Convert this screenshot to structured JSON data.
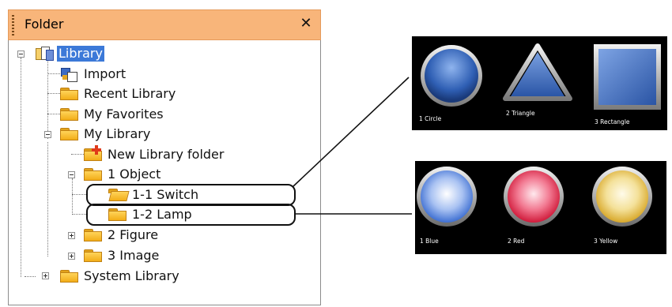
{
  "panel": {
    "title": "Folder",
    "close_glyph": "✕"
  },
  "tree": {
    "library": "Library",
    "import": "Import",
    "recent_library": "Recent Library",
    "my_favorites": "My Favorites",
    "my_library": "My Library",
    "new_library_folder": "New Library folder",
    "object": "1 Object",
    "switch": "1-1 Switch",
    "lamp": "1-2 Lamp",
    "figure": "2 Figure",
    "image": "3 Image",
    "system_library": "System Library"
  },
  "switch_preview": {
    "items": [
      "1 Circle",
      "2 Triangle",
      "3 Rectangle"
    ]
  },
  "lamp_preview": {
    "items": [
      "1 Blue",
      "2 Red",
      "3 Yellow"
    ]
  },
  "colors": {
    "header_bg": "#f8b57a",
    "selection_bg": "#3c79d8",
    "callout_stroke": "#111111",
    "preview_bg": "#000000"
  }
}
